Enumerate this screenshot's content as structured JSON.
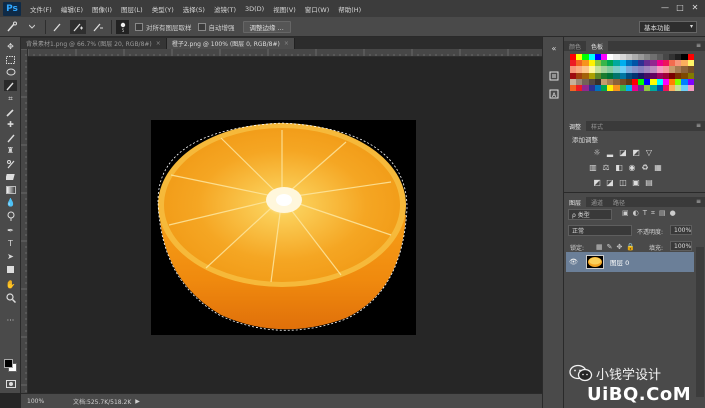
{
  "app": {
    "logo": "Ps"
  },
  "menu": [
    "文件(F)",
    "编辑(E)",
    "图像(I)",
    "图层(L)",
    "类型(Y)",
    "选择(S)",
    "滤镜(T)",
    "3D(D)",
    "视图(V)",
    "窗口(W)",
    "帮助(H)"
  ],
  "window_controls": {
    "minimize": "—",
    "maximize": "□",
    "close": "✕"
  },
  "options": {
    "tool_icon": "quick-selection-icon",
    "sample_all_label": "对所有图层取样",
    "auto_enhance_label": "自动增强",
    "refine_edge_label": "调整边缘 ...",
    "workspace": "基本功能"
  },
  "tabs": [
    {
      "label": "背景素材1.png @ 66.7% (图层 20, RGB/8#)",
      "close": "×",
      "active": false
    },
    {
      "label": "橙子2.png @ 100% (图层 0, RGB/8#)",
      "close": "×",
      "active": true
    }
  ],
  "statusbar": {
    "zoom": "100%",
    "doc_info": "文档:525.7K/518.2K",
    "arrow": "▶"
  },
  "panels": {
    "swatches": {
      "tabs": [
        "颜色",
        "色板"
      ],
      "active": 1
    },
    "adjustments": {
      "tabs": [
        "调整",
        "样式"
      ],
      "active": 0,
      "title": "添加调整"
    },
    "layers": {
      "tabs": [
        "图层",
        "通道",
        "路径"
      ],
      "active": 0,
      "filter_kind": "ρ 类型",
      "blend_mode": "正常",
      "opacity_label": "不透明度:",
      "opacity_value": "100%",
      "lock_label": "锁定:",
      "fill_label": "填充:",
      "fill_value": "100%",
      "layer_name": "图层 0"
    }
  },
  "watermark": {
    "text": "小钱学设计",
    "brand": "UiBQ.CoM"
  },
  "colors": {
    "selection_highlight": "#6b7f98",
    "foreground": "#000000",
    "background": "#ffffff",
    "fruit": "#f3a01f"
  }
}
